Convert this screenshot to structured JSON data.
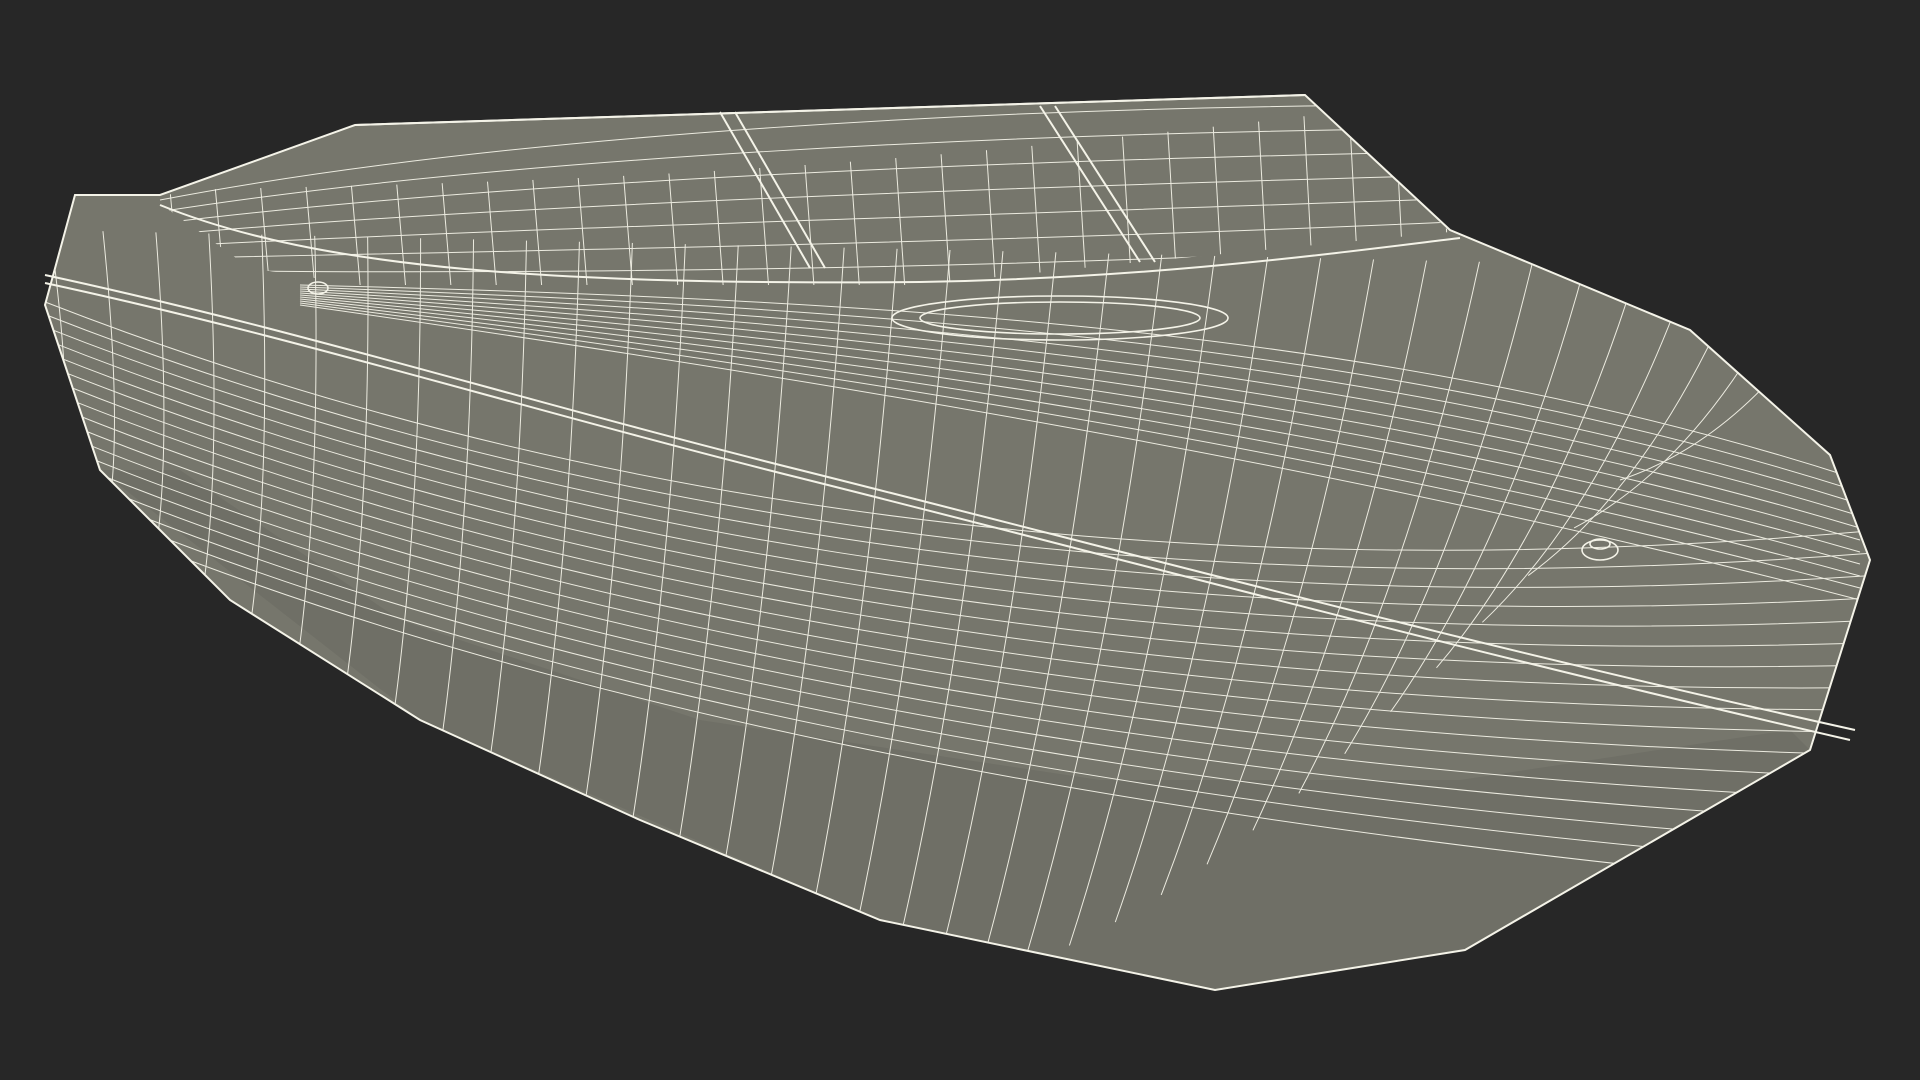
{
  "scene": {
    "subject": "boat-hull-wireframe",
    "colors": {
      "background": "#272727",
      "surface": "#76766c",
      "surface_shade": "#6f6f66",
      "wire": "#ecebe0",
      "wire_strong": "#f4f3e8"
    }
  }
}
